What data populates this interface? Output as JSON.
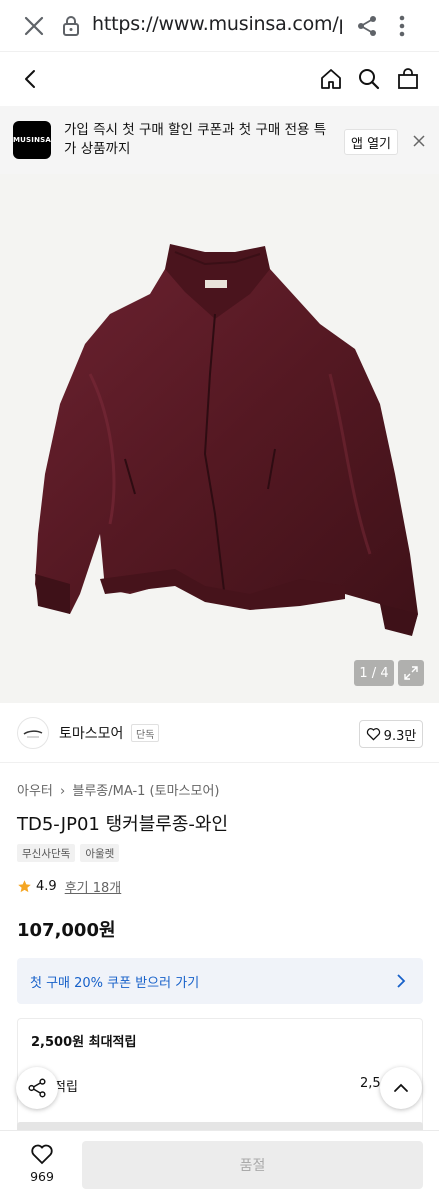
{
  "browser": {
    "url": "https://www.musinsa.com/produ"
  },
  "banner": {
    "logo_text": "MUSINSA",
    "message": "가입 즉시 첫 구매 할인 쿠폰과 첫 구매 전용 특가 상품까지",
    "open_button": "앱 열기"
  },
  "gallery": {
    "counter": "1 / 4"
  },
  "brand": {
    "name": "토마스모어",
    "tag": "단독",
    "likes": "9.3만"
  },
  "product": {
    "breadcrumb_category": "아우터",
    "breadcrumb_subcategory": "블루종/MA-1 (토마스모어)",
    "title": "TD5-JP01 탱커블루종-와인",
    "badges": [
      "무신사단독",
      "아울렛"
    ],
    "rating": "4.9",
    "reviews": "후기 18개",
    "price": "107,000원"
  },
  "coupon": {
    "label": "첫 구매 20% 쿠폰 받으러 가기"
  },
  "points": {
    "max_label": "2,500원 최대적립",
    "line2_label": "적립",
    "line2_value": "2,5"
  },
  "bottom_bar": {
    "like_count": "969",
    "buy_button": "품절"
  },
  "colors": {
    "coupon_text": "#1761c9",
    "coupon_bg": "#f0f3f9",
    "star": "#f5a623",
    "jacket": "#5a1a24"
  }
}
